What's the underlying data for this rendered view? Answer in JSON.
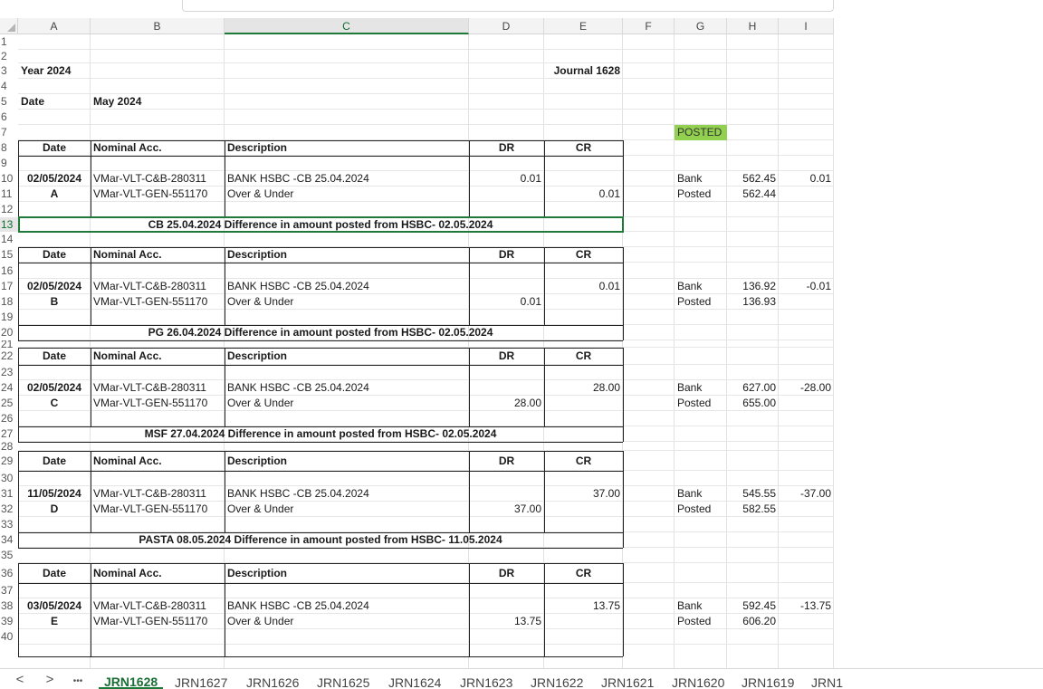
{
  "columns": [
    "A",
    "B",
    "C",
    "D",
    "E",
    "F",
    "G",
    "H",
    "I"
  ],
  "selected_column": "C",
  "selected_row": "13",
  "rows": [
    "1",
    "2",
    "3",
    "4",
    "5",
    "6",
    "7",
    "8",
    "9",
    "10",
    "11",
    "12",
    "13",
    "14",
    "15",
    "16",
    "17",
    "18",
    "19",
    "20",
    "21",
    "22",
    "23",
    "24",
    "25",
    "26",
    "27",
    "28",
    "29",
    "30",
    "31",
    "32",
    "33",
    "34",
    "35",
    "36",
    "37",
    "38",
    "39",
    "40"
  ],
  "header": {
    "year_label": "Year 2024",
    "journal_label": "Journal 1628",
    "date_label": "Date",
    "date_value": "May 2024",
    "posted_badge": "POSTED"
  },
  "table_headers": {
    "date": "Date",
    "nominal": "Nominal Acc.",
    "description": "Description",
    "dr": "DR",
    "cr": "CR"
  },
  "blocks": [
    {
      "date": "02/05/2024",
      "letter": "A",
      "acc1": "VMar-VLT-C&B-280311",
      "acc2": "VMar-VLT-GEN-551170",
      "desc1": "BANK HSBC -CB 25.04.2024",
      "desc2": "Over & Under",
      "dr1": "0.01",
      "cr1": "",
      "dr2": "",
      "cr2": "0.01",
      "g1": "Bank",
      "g2": "Posted",
      "h1": "562.45",
      "h2": "562.44",
      "i1": "0.01",
      "footer": "CB 25.04.2024 Difference in amount posted from HSBC- 02.05.2024"
    },
    {
      "date": "02/05/2024",
      "letter": "B",
      "acc1": "VMar-VLT-C&B-280311",
      "acc2": "VMar-VLT-GEN-551170",
      "desc1": "BANK HSBC -CB 25.04.2024",
      "desc2": "Over & Under",
      "dr1": "",
      "cr1": "0.01",
      "dr2": "0.01",
      "cr2": "",
      "g1": "Bank",
      "g2": "Posted",
      "h1": "136.92",
      "h2": "136.93",
      "i1": "-0.01",
      "footer": "PG 26.04.2024 Difference in amount posted from HSBC- 02.05.2024"
    },
    {
      "date": "02/05/2024",
      "letter": "C",
      "acc1": "VMar-VLT-C&B-280311",
      "acc2": "VMar-VLT-GEN-551170",
      "desc1": "BANK HSBC -CB 25.04.2024",
      "desc2": "Over & Under",
      "dr1": "",
      "cr1": "28.00",
      "dr2": "28.00",
      "cr2": "",
      "g1": "Bank",
      "g2": "Posted",
      "h1": "627.00",
      "h2": "655.00",
      "i1": "-28.00",
      "footer": "MSF 27.04.2024 Difference in amount posted from HSBC- 02.05.2024"
    },
    {
      "date": "11/05/2024",
      "letter": "D",
      "acc1": "VMar-VLT-C&B-280311",
      "acc2": "VMar-VLT-GEN-551170",
      "desc1": "BANK HSBC -CB 25.04.2024",
      "desc2": "Over & Under",
      "dr1": "",
      "cr1": "37.00",
      "dr2": "37.00",
      "cr2": "",
      "g1": "Bank",
      "g2": "Posted",
      "h1": "545.55",
      "h2": "582.55",
      "i1": "-37.00",
      "footer": "PASTA  08.05.2024 Difference in amount posted from HSBC- 11.05.2024"
    },
    {
      "date": "03/05/2024",
      "letter": "E",
      "acc1": "VMar-VLT-C&B-280311",
      "acc2": "VMar-VLT-GEN-551170",
      "desc1": "BANK HSBC -CB 25.04.2024",
      "desc2": "Over & Under",
      "dr1": "",
      "cr1": "13.75",
      "dr2": "13.75",
      "cr2": "",
      "g1": "Bank",
      "g2": "Posted",
      "h1": "592.45",
      "h2": "606.20",
      "i1": "-13.75",
      "footer": ""
    }
  ],
  "sheet_tabs": {
    "prev": "<",
    "next": ">",
    "more": "•••",
    "items": [
      "JRN1628",
      "JRN1627",
      "JRN1626",
      "JRN1625",
      "JRN1624",
      "JRN1623",
      "JRN1622",
      "JRN1621",
      "JRN1620",
      "JRN1619",
      "JRN1"
    ],
    "active": "JRN1628"
  },
  "colors": {
    "accent": "#1f7a3a",
    "posted_badge": "#92d050"
  }
}
